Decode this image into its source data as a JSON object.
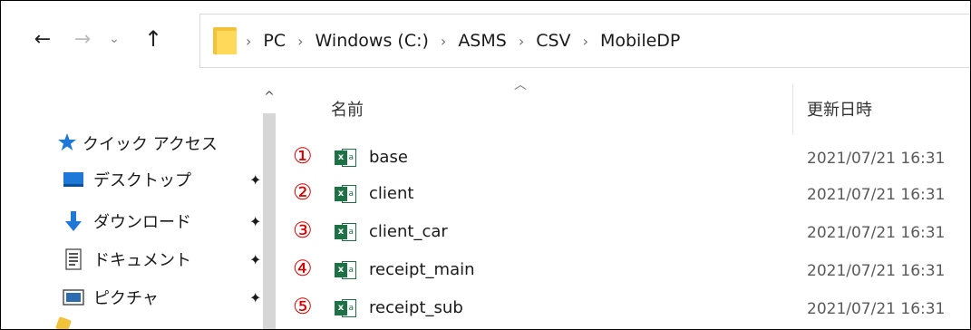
{
  "nav": {
    "back_icon": "arrow-left-icon",
    "forward_icon": "arrow-right-icon",
    "recent_icon": "chevron-down-icon",
    "up_icon": "arrow-up-icon",
    "glyphs": {
      "back": "←",
      "forward": "→",
      "recent": "⌄",
      "up": "↑"
    }
  },
  "address": {
    "folder_icon": "folder-icon",
    "separator": "›",
    "crumbs": [
      "PC",
      "Windows (C:)",
      "ASMS",
      "CSV",
      "MobileDP"
    ]
  },
  "sidebar": {
    "quick_access_label": "クイック アクセス",
    "items": [
      {
        "label": "デスクトップ",
        "icon": "desktop-icon",
        "pinned": true
      },
      {
        "label": "ダウンロード",
        "icon": "download-icon",
        "pinned": true
      },
      {
        "label": "ドキュメント",
        "icon": "document-icon",
        "pinned": true
      },
      {
        "label": "ピクチャ",
        "icon": "pictures-icon",
        "pinned": true
      }
    ]
  },
  "columns": {
    "name": "名前",
    "modified": "更新日時"
  },
  "files": [
    {
      "marker": "①",
      "name": "base",
      "modified": "2021/07/21 16:31"
    },
    {
      "marker": "②",
      "name": "client",
      "modified": "2021/07/21 16:31"
    },
    {
      "marker": "③",
      "name": "client_car",
      "modified": "2021/07/21 16:31"
    },
    {
      "marker": "④",
      "name": "receipt_main",
      "modified": "2021/07/21 16:31"
    },
    {
      "marker": "⑤",
      "name": "receipt_sub",
      "modified": "2021/07/21 16:31"
    }
  ],
  "colors": {
    "marker": "#d00000",
    "excel_green": "#1e7145",
    "folder": "#f2c23a",
    "accent_blue": "#1e78d7"
  }
}
